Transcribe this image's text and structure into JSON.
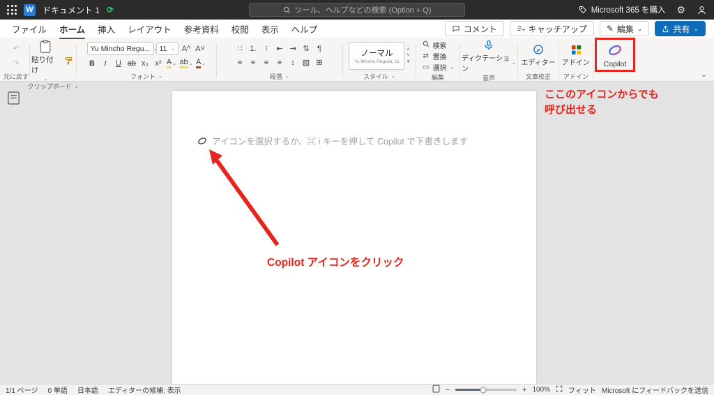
{
  "titlebar": {
    "doc_title": "ドキュメント 1",
    "search_placeholder": "ツール、ヘルプなどの検索 (Option + Q)",
    "buy_label": "Microsoft 365 を購入"
  },
  "menubar": {
    "tabs": [
      "ファイル",
      "ホーム",
      "挿入",
      "レイアウト",
      "参考資料",
      "校閲",
      "表示",
      "ヘルプ"
    ],
    "active_tab": "ホーム",
    "comment_label": "コメント",
    "catchup_label": "キャッチアップ",
    "edit_label": "編集",
    "share_label": "共有"
  },
  "ribbon": {
    "undo_group_label": "元に戻す",
    "paste_label": "貼り付け",
    "clipboard_group_label": "クリップボード",
    "font_name": "Yu Mincho Regu...",
    "font_size": "11",
    "grow_font": "A^",
    "shrink_font": "A˅",
    "bold": "B",
    "italic": "I",
    "underline": "U",
    "strikethrough": "ab",
    "subscript": "x₂",
    "superscript": "x²",
    "effects": "A",
    "highlight": "ab",
    "font_color": "A",
    "font_group_label": "フォント",
    "paragraph_group_label": "段落",
    "style_name": "ノーマル",
    "style_detail": "Yu Mincho Regular, 11",
    "style_group_label": "スタイル",
    "find_label": "検索",
    "replace_label": "置換",
    "select_label": "選択",
    "editing_group_label": "編集",
    "dictate_label": "ディクテーション",
    "voice_group_label": "音声",
    "editor_label": "エディター",
    "proofing_group_label": "文章校正",
    "addins_label": "アドイン",
    "addins_group_label": "アドイン",
    "copilot_label": "Copilot"
  },
  "document": {
    "placeholder": "アイコンを選択するか、⌘ i キーを押して Copilot で下書きします"
  },
  "annotations": {
    "note_line1": "ここのアイコンからでも",
    "note_line2": "呼び出せる",
    "caption": "Copilot アイコンをクリック"
  },
  "statusbar": {
    "page_count": "1/1 ページ",
    "word_count": "0 単語",
    "language": "日本語",
    "editor_suggestions": "エディターの候補: 表示",
    "zoom_level": "100%",
    "fit_label": "フィット",
    "feedback_label": "Microsoft にフィードバックを送信"
  },
  "icons": {
    "chevron_down": "⌄",
    "dropdown": "▾",
    "undo": "↶",
    "redo": "↷",
    "bullets": "∷",
    "numbering": "1.",
    "multilevel": "⁝",
    "outdent": "⇤",
    "indent": "⇥",
    "sort": "⇅",
    "pilcrow": "¶",
    "align": "≡",
    "line_spacing": "↕",
    "shading": "▨",
    "borders": "⊞",
    "replace": "⇄",
    "select": "▭",
    "pencil": "✎",
    "gear": "⚙",
    "saved": "⟳",
    "minus": "−",
    "plus": "+"
  },
  "colors": {
    "annotation_red": "#e5261f",
    "share_blue": "#0f6cbd",
    "word_blue": "#2b7cd3",
    "titlebar_bg": "#2b2b2b"
  }
}
